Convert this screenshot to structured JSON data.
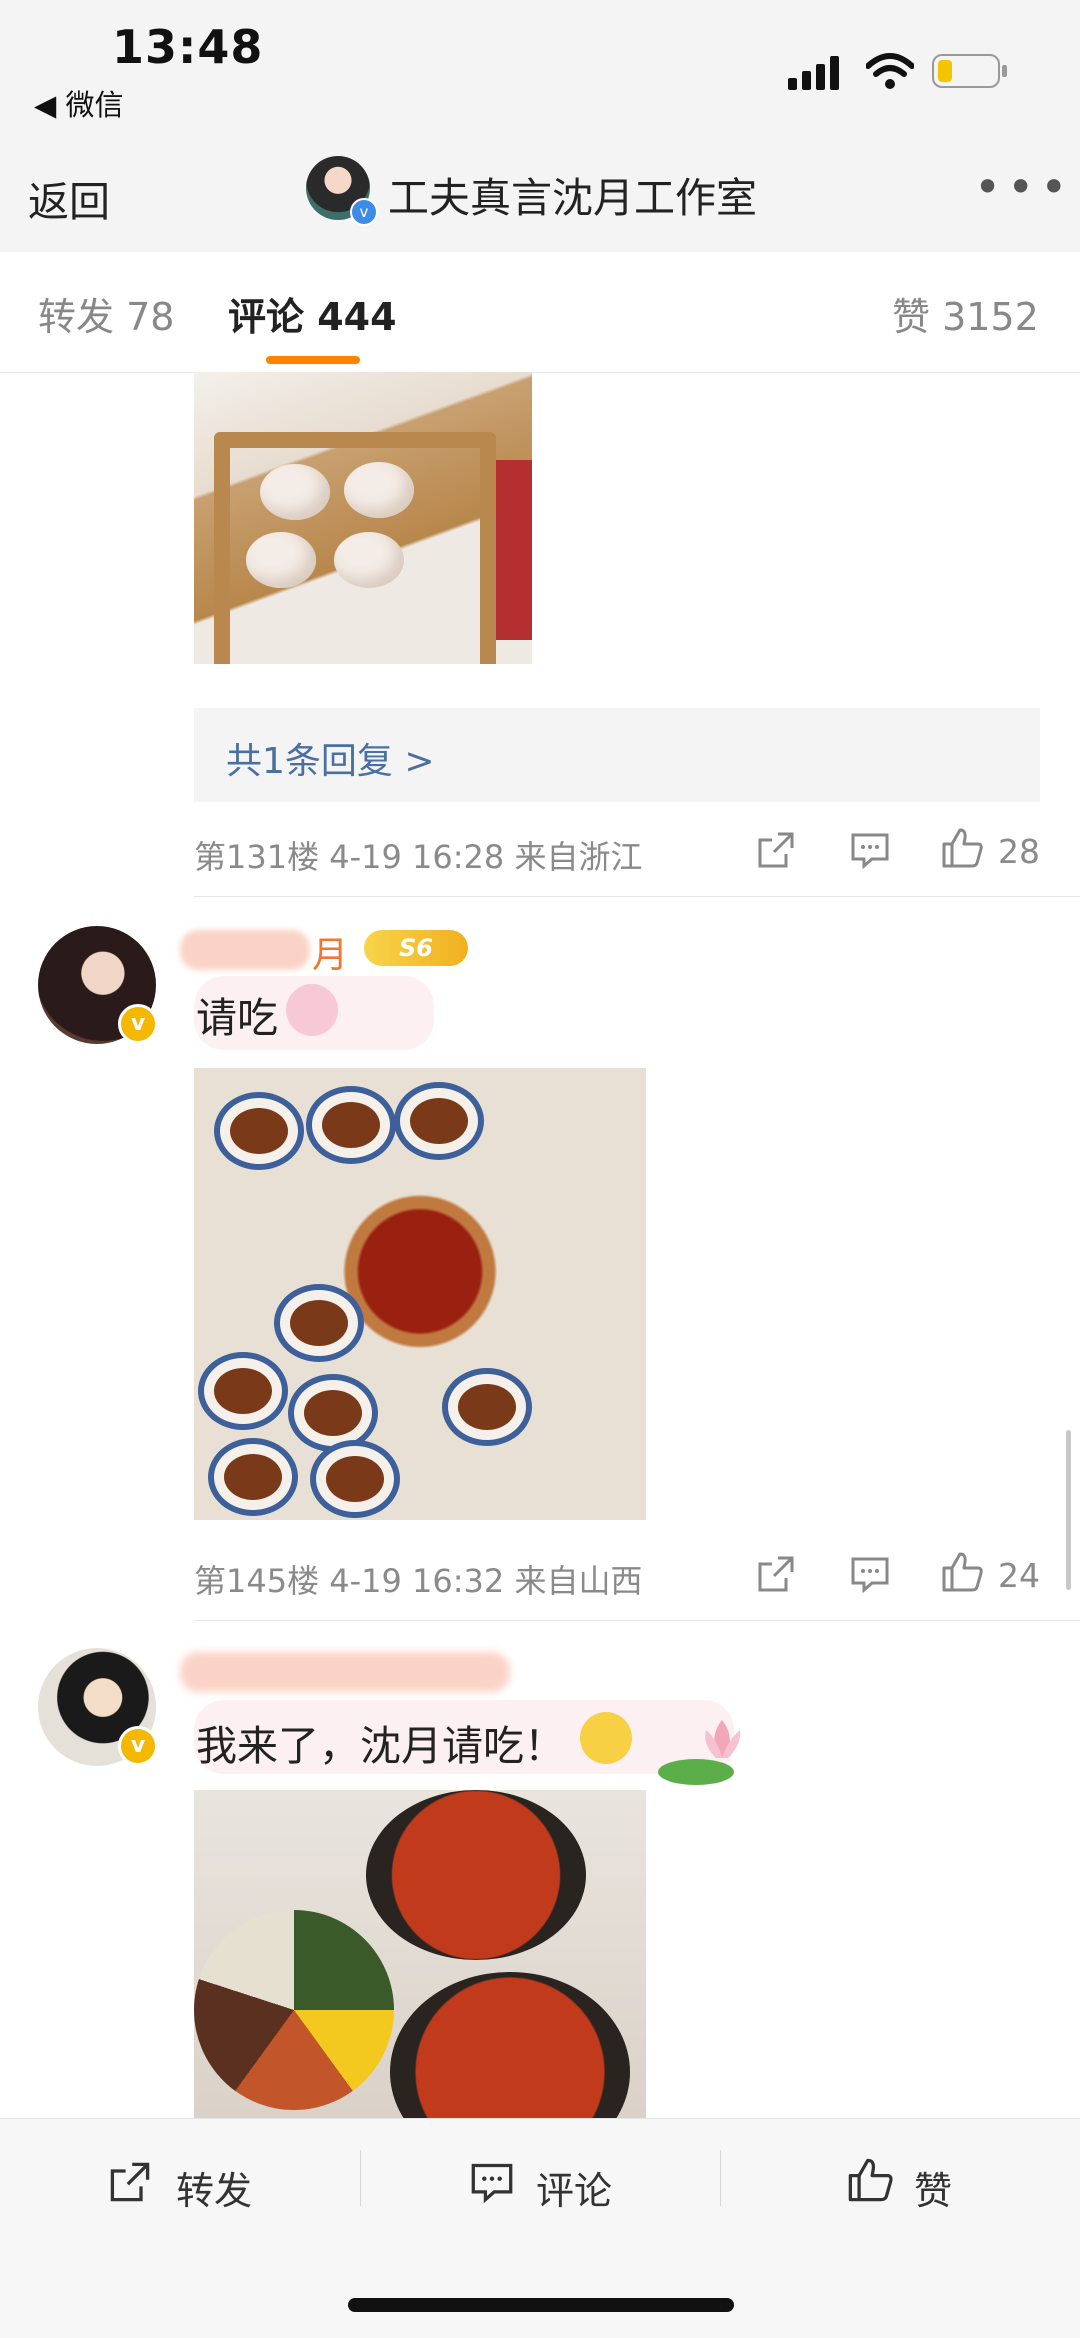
{
  "status_bar": {
    "time": "13:48",
    "back_app": "◀ 微信"
  },
  "nav": {
    "back_label": "返回",
    "title": "工夫真言沈月工作室",
    "more": "•••"
  },
  "tabs": [
    {
      "label": "转发 78"
    },
    {
      "label": "评论 444"
    },
    {
      "label": "赞 3152"
    }
  ],
  "comments": [
    {
      "reply_summary": "共1条回复 >",
      "meta": "第131楼  4-19 16:28  来自浙江",
      "likes": "28"
    },
    {
      "name_visible": "月",
      "level": "S6",
      "text": "请吃",
      "meta": "第145楼  4-19 16:32  来自山西",
      "likes": "24"
    },
    {
      "text": "我来了，沈月请吃！"
    }
  ],
  "bottom_bar": {
    "repost": "转发",
    "comment": "评论",
    "like": "赞"
  },
  "colors": {
    "accent": "#ff8200",
    "link": "#4a6fa0",
    "verified_gold": "#f5b800",
    "verified_blue": "#3d8ce8"
  }
}
